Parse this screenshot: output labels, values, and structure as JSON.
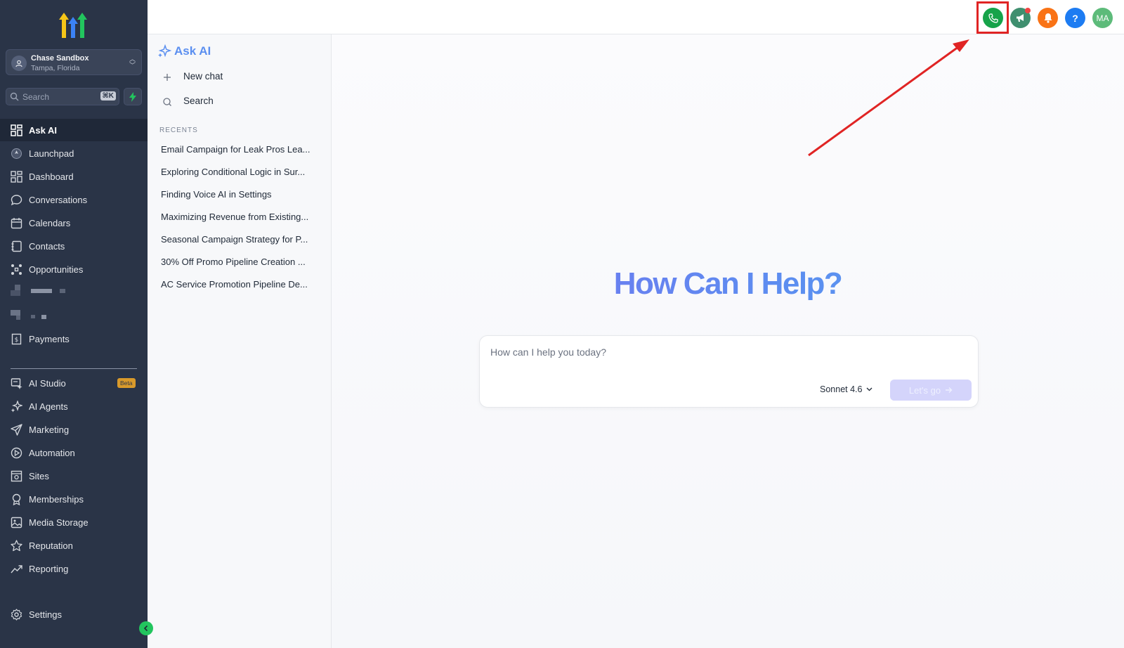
{
  "sidebar": {
    "account": {
      "name": "Chase Sandbox",
      "location": "Tampa, Florida"
    },
    "search": {
      "placeholder": "Search",
      "shortcut": "⌘K"
    },
    "nav_primary": [
      {
        "label": "Ask AI",
        "icon": "grid-icon"
      },
      {
        "label": "Launchpad",
        "icon": "launchpad-icon"
      },
      {
        "label": "Dashboard",
        "icon": "dashboard-icon"
      },
      {
        "label": "Conversations",
        "icon": "chat-bubble-icon"
      },
      {
        "label": "Calendars",
        "icon": "calendar-icon"
      },
      {
        "label": "Contacts",
        "icon": "contacts-icon"
      },
      {
        "label": "Opportunities",
        "icon": "opportunities-icon"
      },
      {
        "label": "Payments",
        "icon": "receipt-icon"
      }
    ],
    "nav_secondary": [
      {
        "label": "AI Studio",
        "icon": "ai-studio-icon",
        "badge": "Beta"
      },
      {
        "label": "AI Agents",
        "icon": "sparkle-icon"
      },
      {
        "label": "Marketing",
        "icon": "send-icon"
      },
      {
        "label": "Automation",
        "icon": "automation-icon"
      },
      {
        "label": "Sites",
        "icon": "sites-icon"
      },
      {
        "label": "Memberships",
        "icon": "ribbon-icon"
      },
      {
        "label": "Media Storage",
        "icon": "image-icon"
      },
      {
        "label": "Reputation",
        "icon": "star-icon"
      },
      {
        "label": "Reporting",
        "icon": "trend-icon"
      }
    ],
    "settings_label": "Settings"
  },
  "topbar": {
    "buttons": [
      {
        "name": "phone",
        "color": "#16a34a"
      },
      {
        "name": "announcements",
        "color": "#3f8f6f"
      },
      {
        "name": "notifications",
        "color": "#f97316"
      },
      {
        "name": "help",
        "color": "#1d7cf2",
        "glyph": "?"
      },
      {
        "name": "avatar",
        "color": "#5dbb7a",
        "initials": "MA"
      }
    ]
  },
  "chat_panel": {
    "title": "Ask AI",
    "new_chat": "New chat",
    "search": "Search",
    "recents_label": "RECENTS",
    "recents": [
      "Email Campaign for Leak Pros Lea...",
      "Exploring Conditional Logic in Sur...",
      "Finding Voice AI in Settings",
      "Maximizing Revenue from Existing...",
      "Seasonal Campaign Strategy for P...",
      "30% Off Promo Pipeline Creation ...",
      "AC Service Promotion Pipeline De..."
    ]
  },
  "main": {
    "headline": "How Can I Help?",
    "prompt_placeholder": "How can I help you today?",
    "model": "Sonnet 4.6",
    "go_label": "Let's go"
  },
  "colors": {
    "sidebar_bg": "#2a3447",
    "accent_blue": "#5b8ff0",
    "annotation_red": "#e02424"
  }
}
